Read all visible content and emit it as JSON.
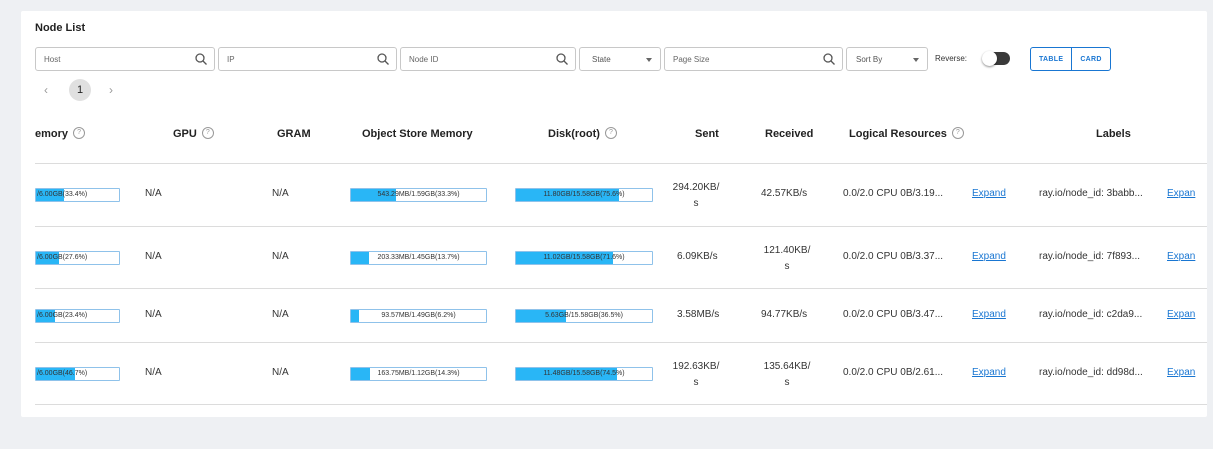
{
  "panel": {
    "title": "Node List"
  },
  "filters": {
    "host_placeholder": "Host",
    "ip_placeholder": "IP",
    "node_id_placeholder": "Node ID",
    "state_label": "State",
    "page_size_placeholder": "Page Size",
    "sort_by_label": "Sort By",
    "reverse_label": "Reverse:",
    "view_table": "TABLE",
    "view_card": "CARD"
  },
  "pagination": {
    "prev": "‹",
    "current": "1",
    "next": "›"
  },
  "columns": {
    "memory": "emory",
    "gpu": "GPU",
    "gram": "GRAM",
    "object_store_memory": "Object Store Memory",
    "disk": "Disk(root)",
    "sent": "Sent",
    "received": "Received",
    "logical_resources": "Logical Resources",
    "labels": "Labels"
  },
  "help_icon": "?",
  "expand_label": "Expand",
  "expand_label_clipped": "Expan",
  "rows": [
    {
      "memory": "/6.00GB(33.4%)",
      "memory_pct": 33.4,
      "gpu": "N/A",
      "gram": "N/A",
      "obj": "543.29MB/1.59GB(33.3%)",
      "obj_pct": 33.3,
      "disk": "11.80GB/15.58GB(75.6%)",
      "disk_pct": 75.6,
      "sent": "294.20KB/ s",
      "received": "42.57KB/s",
      "logical": "0.0/2.0 CPU 0B/3.19...",
      "labels": "ray.io/node_id: 3babb..."
    },
    {
      "memory": "/6.00GB(27.6%)",
      "memory_pct": 27.6,
      "gpu": "N/A",
      "gram": "N/A",
      "obj": "203.33MB/1.45GB(13.7%)",
      "obj_pct": 13.7,
      "disk": "11.02GB/15.58GB(71.6%)",
      "disk_pct": 71.6,
      "sent": "6.09KB/s",
      "received": "121.40KB/ s",
      "logical": "0.0/2.0 CPU 0B/3.37...",
      "labels": "ray.io/node_id: 7f893..."
    },
    {
      "memory": "/6.00GB(23.4%)",
      "memory_pct": 23.4,
      "gpu": "N/A",
      "gram": "N/A",
      "obj": "93.57MB/1.49GB(6.2%)",
      "obj_pct": 6.2,
      "disk": "5.63GB/15.58GB(36.5%)",
      "disk_pct": 36.5,
      "sent": "3.58MB/s",
      "received": "94.77KB/s",
      "logical": "0.0/2.0 CPU 0B/3.47...",
      "labels": "ray.io/node_id: c2da9..."
    },
    {
      "memory": "/6.00GB(46.7%)",
      "memory_pct": 46.7,
      "gpu": "N/A",
      "gram": "N/A",
      "obj": "163.75MB/1.12GB(14.3%)",
      "obj_pct": 14.3,
      "disk": "11.48GB/15.58GB(74.5%)",
      "disk_pct": 74.5,
      "sent": "192.63KB/ s",
      "received": "135.64KB/ s",
      "logical": "0.0/2.0 CPU 0B/2.61...",
      "labels": "ray.io/node_id: dd98d..."
    }
  ],
  "colors": {
    "accent": "#1976d2",
    "bar_fill": "#29b6f6",
    "bar_border": "#8fc2ea"
  }
}
